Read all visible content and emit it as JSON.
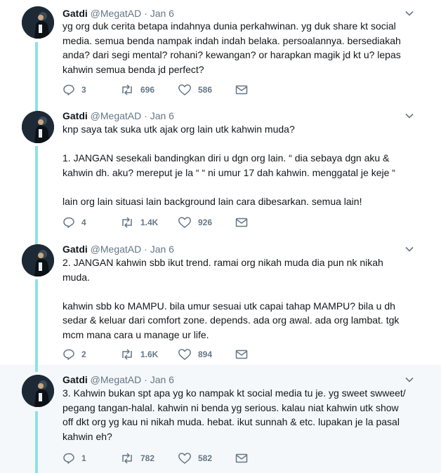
{
  "tweets": [
    {
      "author": "Gatdi",
      "handle": "@MegatAD",
      "dot": "·",
      "date": "Jan 6",
      "paragraphs": [
        "yg org duk cerita betapa indahnya dunia perkahwinan. yg duk share kt social media. semua benda nampak indah indah belaka. persoalannya. bersediakah anda? dari segi mental? rohani? kewangan? or harapkan magik jd kt u? lepas kahwin semua benda jd perfect?"
      ],
      "replies": "3",
      "retweets": "696",
      "likes": "586"
    },
    {
      "author": "Gatdi",
      "handle": "@MegatAD",
      "dot": "·",
      "date": "Jan 6",
      "paragraphs": [
        "knp saya tak suka utk ajak org lain utk kahwin muda?",
        "1. JANGAN sesekali bandingkan diri u dgn org lain. “ dia sebaya dgn aku & kahwin dh. aku? mereput je la “ “ ni umur 17 dah kahwin. menggatal je keje “",
        "lain org lain situasi lain background lain cara dibesarkan. semua lain!"
      ],
      "replies": "4",
      "retweets": "1.4K",
      "likes": "926"
    },
    {
      "author": "Gatdi",
      "handle": "@MegatAD",
      "dot": "·",
      "date": "Jan 6",
      "paragraphs": [
        "2. JANGAN kahwin sbb ikut trend. ramai org nikah muda dia pun nk nikah muda.",
        "kahwin sbb ko MAMPU. bila umur sesuai utk capai tahap MAMPU? bila u dh sedar & keluar dari comfort zone. depends. ada org awal. ada org lambat. tgk mcm mana cara u manage ur life."
      ],
      "replies": "2",
      "retweets": "1.6K",
      "likes": "894"
    },
    {
      "author": "Gatdi",
      "handle": "@MegatAD",
      "dot": "·",
      "date": "Jan 6",
      "paragraphs": [
        "3. Kahwin bukan spt apa yg ko nampak kt social media tu je. yg sweet swweet/ pegang tangan-halal. kahwin ni benda yg serious. kalau niat kahwin utk show off dkt org yg kau ni nikah muda. hebat. ikut sunnah & etc. lupakan je la pasal kahwin eh?"
      ],
      "replies": "1",
      "retweets": "782",
      "likes": "582"
    }
  ],
  "icons": {
    "reply": "reply-icon",
    "retweet": "retweet-icon",
    "like": "heart-icon",
    "message": "envelope-icon",
    "caret": "chevron-down-icon"
  },
  "colors": {
    "thread_line": "#8fe0e8",
    "muted": "#657786",
    "text": "#14171a",
    "highlight_bg": "#f5f8fa"
  }
}
